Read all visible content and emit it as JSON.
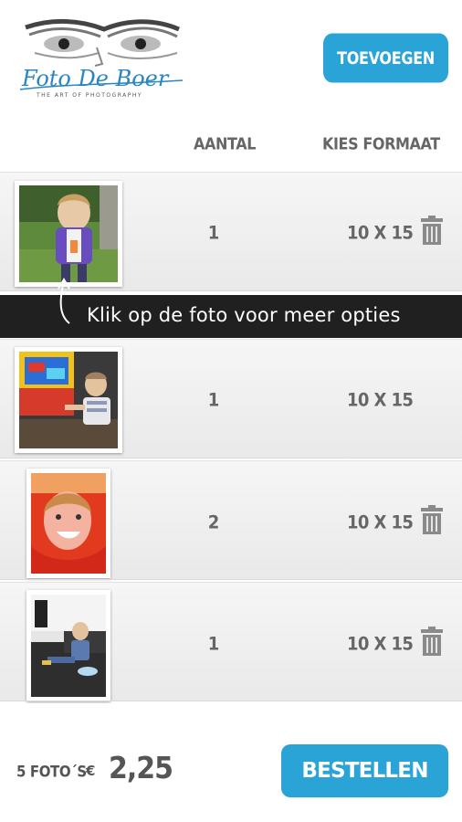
{
  "header": {
    "logo_text": "Foto De Boer",
    "logo_tagline": "THE ART OF PHOTOGRAPHY",
    "add_button": "TOEVOEGEN"
  },
  "columns": {
    "quantity": "AANTAL",
    "format": "KIES FORMAAT"
  },
  "tip": "Klik op de foto voor meer opties",
  "items": [
    {
      "quantity": "1",
      "format": "10 X 15",
      "photo": "girl-in-purple-jacket-photo"
    },
    {
      "quantity": "1",
      "format": "10 X 15",
      "photo": "boy-at-arcade-game-photo"
    },
    {
      "quantity": "2",
      "format": "10 X 15",
      "photo": "child-in-red-hood-photo"
    },
    {
      "quantity": "1",
      "format": "10 X 15",
      "photo": "toddler-on-floor-photo"
    }
  ],
  "footer": {
    "count": "5 FOTO´S",
    "currency": "€",
    "total": "2,25",
    "order_button": "BESTELLEN"
  },
  "colors": {
    "accent": "#2aa3d6",
    "tip_bar": "#202020",
    "text_gray": "#666666"
  },
  "icons": {
    "delete": "trash-icon",
    "tip_arrow": "curved-arrow-up-icon"
  }
}
